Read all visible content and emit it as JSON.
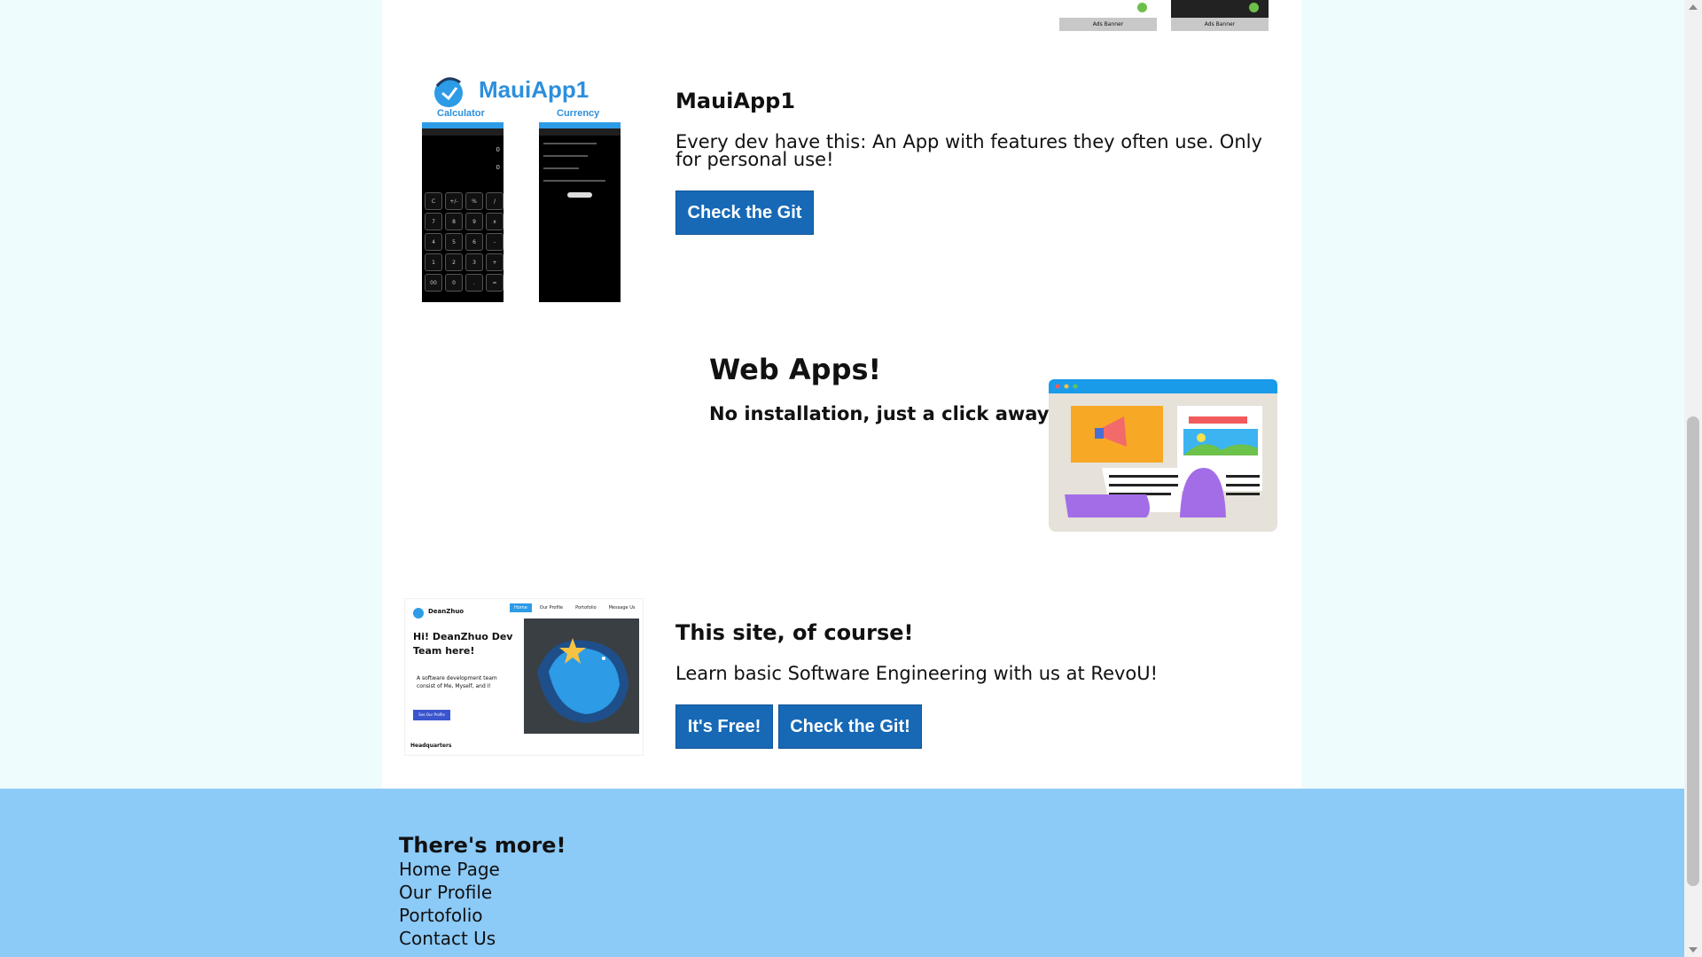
{
  "top_preview": {
    "banner_left": "Ads Banner",
    "banner_right": "Ads Banner"
  },
  "mauiapp": {
    "thumb_title": "MauiApp1",
    "thumb_label_left": "Calculator",
    "thumb_label_right": "Currency",
    "calc_keys": [
      "C",
      "+/-",
      "%",
      "/",
      "7",
      "8",
      "9",
      "x",
      "4",
      "5",
      "6",
      "-",
      "1",
      "2",
      "3",
      "+",
      "00",
      "0",
      ".",
      "="
    ],
    "title": "MauiApp1",
    "description": "Every dev have this: An App with features they often use. Only for personal use!",
    "button": "Check the Git"
  },
  "webapps": {
    "title": "Web Apps!",
    "subtitle": "No installation, just a click away!"
  },
  "site": {
    "thumb_brand": "DeanZhuo",
    "thumb_nav": [
      "Home",
      "Our Profile",
      "Portofolio",
      "Message Us"
    ],
    "thumb_heading": "Hi! DeanZhuo Dev Team here!",
    "thumb_text": "A software development team consist of Me, Myself, and I!",
    "thumb_button": "See Our Profile",
    "thumb_footer": "Headquarters",
    "title": "This site, of course!",
    "description": "Learn basic Software Engineering with us at RevoU!",
    "button_free": "It's Free!",
    "button_git": "Check the Git!"
  },
  "footer": {
    "title": "There's more!",
    "links": [
      "Home Page",
      "Our Profile",
      "Portofolio",
      "Contact Us"
    ]
  },
  "colors": {
    "page_bg": "#eefcfd",
    "footer_bg": "#8ccaf7",
    "button_bg": "#1769b6",
    "accent_blue": "#2d9be6"
  }
}
